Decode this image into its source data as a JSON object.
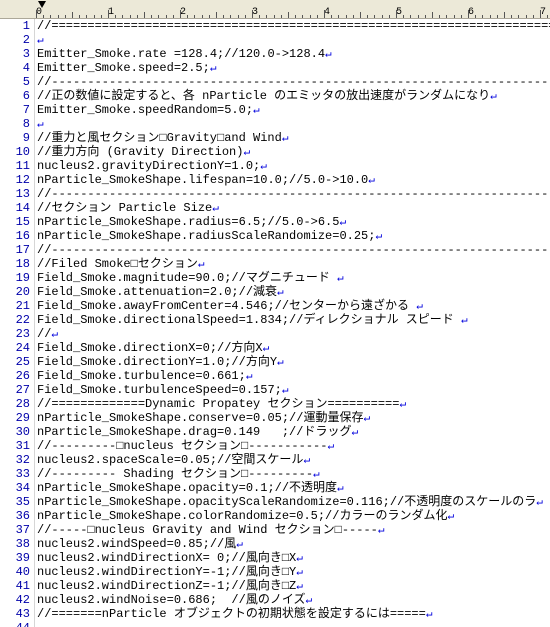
{
  "ruler": {
    "majors": [
      0,
      1,
      2,
      3,
      4,
      5,
      6,
      7
    ]
  },
  "lines": [
    "//========================================================================",
    "",
    "Emitter_Smoke.rate =128.4;//120.0->128.4",
    "Emitter_Smoke.speed=2.5;",
    "//------------------------------------------------------------------------",
    "//正の数値に設定すると、各 nParticle のエミッタの放出速度がランダムになり",
    "Emitter_Smoke.speedRandom=5.0;",
    "",
    "//重力と風セクション□Gravity□and Wind",
    "//重力方向 (Gravity Direction)",
    "nucleus2.gravityDirectionY=1.0;",
    "nParticle_SmokeShape.lifespan=10.0;//5.0->10.0",
    "//------------------------------------------------------------------------",
    "//セクション Particle Size",
    "nParticle_SmokeShape.radius=6.5;//5.0->6.5",
    "nParticle_SmokeShape.radiusScaleRandomize=0.25;",
    "//------------------------------------------------------------------------",
    "//Filed Smoke□セクション",
    "Field_Smoke.magnitude=90.0;//マグニチュード ",
    "Field_Smoke.attenuation=2.0;//減衰",
    "Field_Smoke.awayFromCenter=4.546;//センターから遠ざかる ",
    "Field_Smoke.directionalSpeed=1.834;//ディレクショナル スピード ",
    "//",
    "Field_Smoke.directionX=0;//方向X",
    "Field_Smoke.directionY=1.0;//方向Y",
    "Field_Smoke.turbulence=0.661;",
    "Field_Smoke.turbulenceSpeed=0.157;",
    "//=============Dynamic Propatey セクション==========",
    "nParticle_SmokeShape.conserve=0.05;//運動量保存",
    "nParticle_SmokeShape.drag=0.149   ;//ドラッグ",
    "//---------□nucleus セクション□-----------",
    "nucleus2.spaceScale=0.05;//空間スケール",
    "//--------- Shading セクション□---------",
    "nParticle_SmokeShape.opacity=0.1;//不透明度",
    "nParticle_SmokeShape.opacityScaleRandomize=0.116;//不透明度のスケールのラ",
    "nParticle_SmokeShape.colorRandomize=0.5;//カラーのランダム化",
    "//-----□nucleus Gravity and Wind セクション□-----",
    "nucleus2.windSpeed=0.85;//風",
    "nucleus2.windDirectionX= 0;//風向き□X",
    "nucleus2.windDirectionY=-1;//風向き□Y",
    "nucleus2.windDirectionZ=-1;//風向き□Z",
    "nucleus2.windNoise=0.686;  //風のノイズ",
    "//=======nParticle オブジェクトの初期状態を設定するには====="
  ],
  "lastLineNumber": 44,
  "eol": "↵",
  "eof": "[EOF]"
}
